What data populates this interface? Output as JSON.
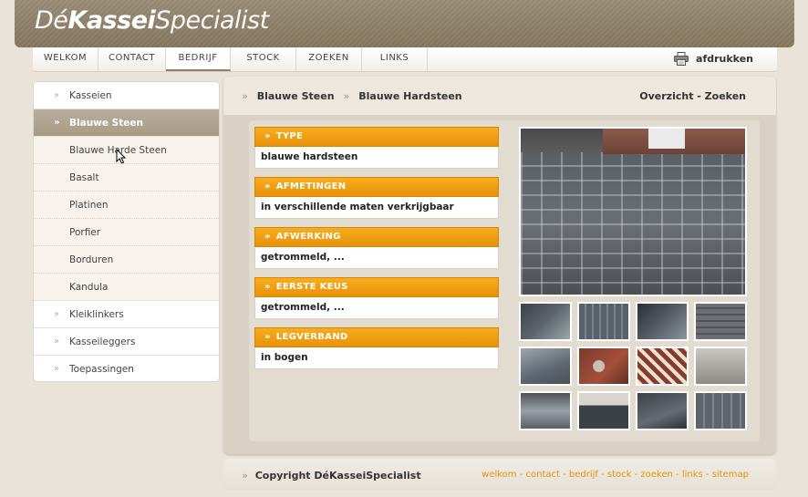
{
  "brand": {
    "pre": "Dé",
    "bold": "Kassei",
    "post": "Specialist"
  },
  "nav": {
    "tabs": [
      {
        "label": "WELKOM"
      },
      {
        "label": "CONTACT"
      },
      {
        "label": "BEDRIJF"
      },
      {
        "label": "STOCK"
      },
      {
        "label": "ZOEKEN"
      },
      {
        "label": "LINKS"
      }
    ],
    "active_tab": "BEDRIJF",
    "print_label": "afdrukken"
  },
  "sidebar": {
    "items": [
      {
        "label": "Kasseien",
        "type": "main"
      },
      {
        "label": "Blauwe Steen",
        "type": "active"
      },
      {
        "label": "Blauwe Harde Steen",
        "type": "sub"
      },
      {
        "label": "Basalt",
        "type": "sub"
      },
      {
        "label": "Platinen",
        "type": "sub"
      },
      {
        "label": "Porfier",
        "type": "sub"
      },
      {
        "label": "Borduren",
        "type": "sub"
      },
      {
        "label": "Kandula",
        "type": "sub"
      },
      {
        "label": "Kleiklinkers",
        "type": "main"
      },
      {
        "label": "Kasseileggers",
        "type": "main"
      },
      {
        "label": "Toepassingen",
        "type": "main"
      }
    ]
  },
  "breadcrumb": {
    "first": "Blauwe Steen",
    "second": "Blauwe Hardsteen"
  },
  "overview_link": "Overzicht - Zoeken",
  "properties": [
    {
      "header": "TYPE",
      "value": "blauwe hardsteen"
    },
    {
      "header": "AFMETINGEN",
      "value": "in verschillende maten verkrijgbaar"
    },
    {
      "header": "AFWERKING",
      "value": "getrommeld, ..."
    },
    {
      "header": "EERSTE KEUS",
      "value": "getrommeld, ..."
    },
    {
      "header": "LEGVERBAND",
      "value": "in bogen"
    }
  ],
  "footer": {
    "copyright": "Copyright DéKasseiSpecialist",
    "links": [
      "welkom",
      "contact",
      "bedrijf",
      "stock",
      "zoeken",
      "links",
      "sitemap"
    ],
    "separator": " - "
  },
  "colors": {
    "accent": "#f0a010",
    "header_bg": "#8f8169",
    "active_item": "#aea290"
  }
}
